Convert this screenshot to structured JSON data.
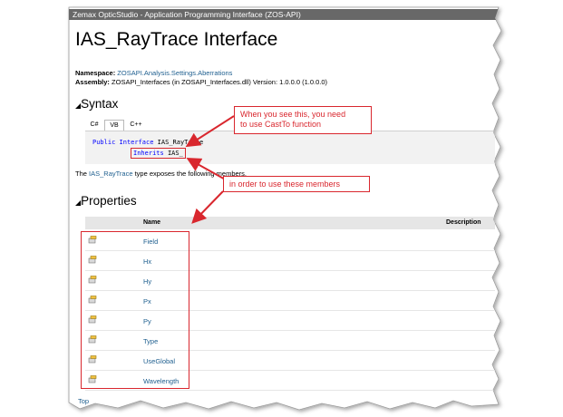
{
  "window": {
    "title": "Zemax OpticStudio - Application Programming Interface (ZOS-API)"
  },
  "page": {
    "title": "IAS_RayTrace Interface",
    "namespace_label": "Namespace:",
    "namespace_value": "ZOSAPI.Analysis.Settings.Aberrations",
    "assembly_label": "Assembly:",
    "assembly_value": "ZOSAPI_Interfaces (in ZOSAPI_Interfaces.dll) Version: 1.0.0.0 (1.0.0.0)"
  },
  "syntax": {
    "heading": "Syntax",
    "tabs": [
      "C#",
      "VB",
      "C++"
    ],
    "active_tab": "VB",
    "code": {
      "kw1": "Public",
      "kw2": "Interface",
      "name": "IAS_RayTrace",
      "inherits_kw": "Inherits",
      "inherits_name": "IAS_"
    }
  },
  "description": {
    "prefix": "The ",
    "link": "IAS_RayTrace",
    "suffix": " type exposes the following members."
  },
  "properties": {
    "heading": "Properties",
    "col_name": "Name",
    "col_description": "Description",
    "rows": [
      "Field",
      "Hx",
      "Hy",
      "Px",
      "Py",
      "Type",
      "UseGlobal",
      "Wavelength"
    ]
  },
  "callouts": {
    "cast": [
      "When you see this, you need",
      "to use CastTo function"
    ],
    "members": "in order to use these members"
  },
  "bottom_link": "Top",
  "colors": {
    "annotation": "#d9272e",
    "link": "#1f5f8f",
    "keyword": "#0000ff",
    "titlebar": "#686868"
  }
}
